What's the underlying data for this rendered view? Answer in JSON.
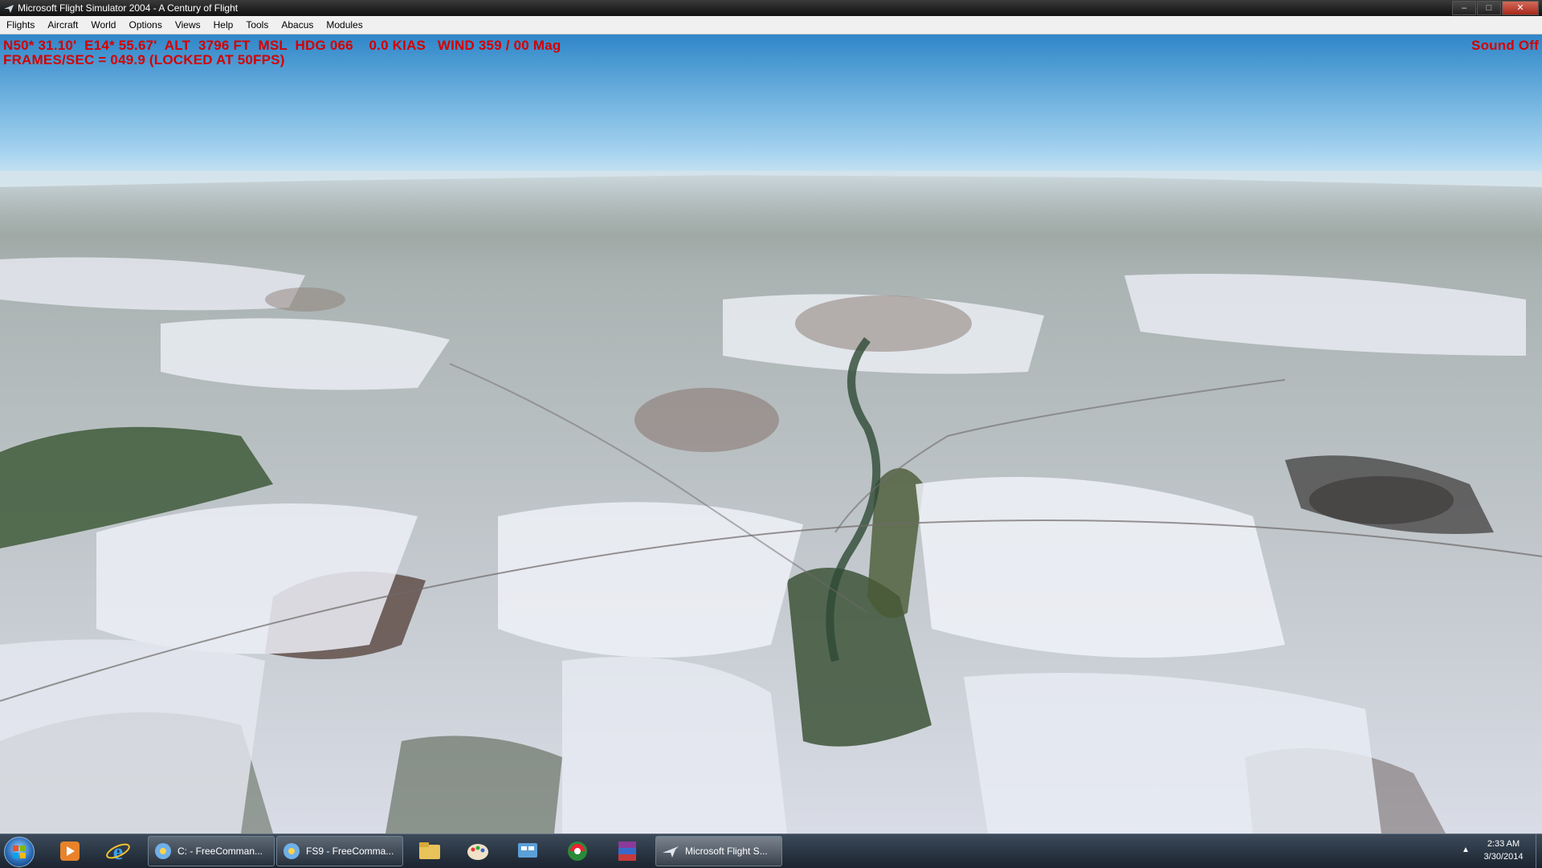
{
  "window": {
    "title": "Microsoft Flight Simulator 2004 - A Century of Flight",
    "buttons": [
      "minimize",
      "maximize",
      "close"
    ]
  },
  "menu": {
    "items": [
      "Flights",
      "Aircraft",
      "World",
      "Options",
      "Views",
      "Help",
      "Tools",
      "Abacus",
      "Modules"
    ]
  },
  "hud": {
    "line1": "N50* 31.10'  E14* 55.67'  ALT  3796 FT  MSL  HDG 066    0.0 KIAS   WIND 359 / 00 Mag",
    "line2": "FRAMES/SEC = 049.9 (LOCKED AT 50FPS)",
    "sound": "Sound Off",
    "color": "#d40000"
  },
  "taskbar": {
    "pinned_icons": [
      "windows-media-player-icon",
      "internet-explorer-icon"
    ],
    "tasks": [
      {
        "label": "C: - FreeComman...",
        "icon": "freecommander-icon"
      },
      {
        "label": "FS9 - FreeComma...",
        "icon": "freecommander-icon"
      }
    ],
    "more_icons": [
      "file-explorer-icon",
      "paint-icon",
      "control-panel-icon",
      "media-center-icon",
      "winrar-icon"
    ],
    "active_task": {
      "label": "Microsoft Flight S...",
      "icon": "airplane-icon"
    },
    "clock": {
      "time": "2:33 AM",
      "date": "3/30/2014"
    }
  }
}
